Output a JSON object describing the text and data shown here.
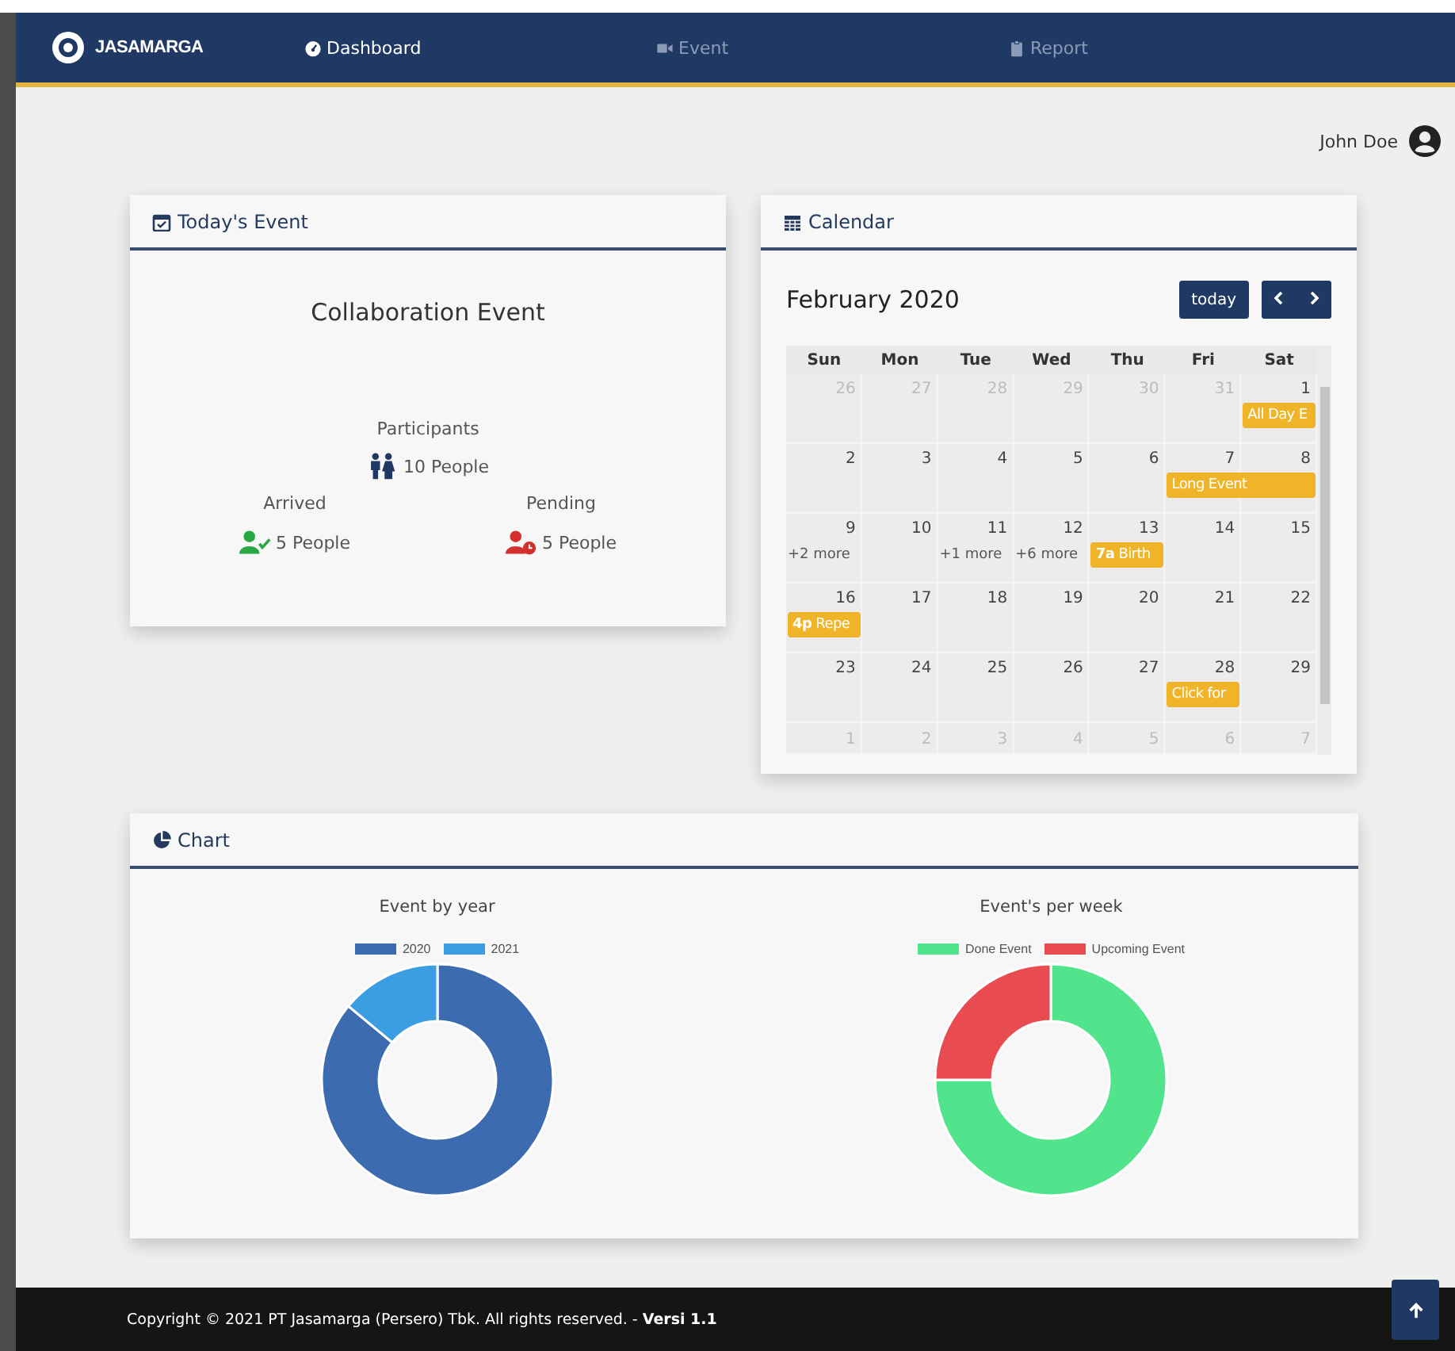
{
  "navbar": {
    "logo": "JASAMARGA",
    "items": [
      {
        "label": "Dashboard",
        "selected": true
      },
      {
        "label": "Event",
        "selected": false
      },
      {
        "label": "Report",
        "selected": false
      }
    ]
  },
  "user": {
    "name": "John Doe"
  },
  "todays_event": {
    "title": "Today's Event",
    "event_name": "Collaboration Event",
    "stats": [
      {
        "kind": "participants",
        "label": "Participants",
        "value": "10 People"
      },
      {
        "kind": "arrived",
        "label": "Arrived",
        "value": "5 People"
      },
      {
        "kind": "pending",
        "label": "Pending",
        "value": "5 People"
      }
    ]
  },
  "calendar": {
    "title": "Calendar",
    "month": "February 2020",
    "today_button": "today",
    "weekdays": [
      "Sun",
      "Mon",
      "Tue",
      "Wed",
      "Thu",
      "Fri",
      "Sat"
    ],
    "weeks": [
      {
        "days": [
          {
            "n": "26",
            "other": true
          },
          {
            "n": "27",
            "other": true
          },
          {
            "n": "28",
            "other": true
          },
          {
            "n": "29",
            "other": true
          },
          {
            "n": "30",
            "other": true
          },
          {
            "n": "31",
            "other": true
          },
          {
            "n": "1",
            "other": false,
            "events": [
              {
                "kind": "event",
                "title": "All Day E"
              }
            ]
          }
        ]
      },
      {
        "days": [
          {
            "n": "2",
            "other": false
          },
          {
            "n": "3",
            "other": false
          },
          {
            "n": "4",
            "other": false
          },
          {
            "n": "5",
            "other": false
          },
          {
            "n": "6",
            "other": false
          },
          {
            "n": "7",
            "other": false,
            "events": [
              {
                "kind": "multi-day",
                "title": "Long Event"
              }
            ]
          },
          {
            "n": "8",
            "other": false
          }
        ]
      },
      {
        "days": [
          {
            "n": "9",
            "other": false,
            "events": [
              {
                "kind": "more",
                "title": "+2 more"
              }
            ]
          },
          {
            "n": "10",
            "other": false
          },
          {
            "n": "11",
            "other": false,
            "events": [
              {
                "kind": "more",
                "title": "+1 more"
              }
            ]
          },
          {
            "n": "12",
            "other": false,
            "events": [
              {
                "kind": "more",
                "title": "+6 more"
              }
            ]
          },
          {
            "n": "13",
            "other": false,
            "events": [
              {
                "kind": "event",
                "title": "**7a** Birth"
              }
            ]
          },
          {
            "n": "14",
            "other": false
          },
          {
            "n": "15",
            "other": false
          }
        ]
      },
      {
        "days": [
          {
            "n": "16",
            "other": false,
            "events": [
              {
                "kind": "event",
                "title": "**4p** Repe"
              }
            ]
          },
          {
            "n": "17",
            "other": false
          },
          {
            "n": "18",
            "other": false
          },
          {
            "n": "19",
            "other": false
          },
          {
            "n": "20",
            "other": false
          },
          {
            "n": "21",
            "other": false
          },
          {
            "n": "22",
            "other": false
          }
        ]
      },
      {
        "days": [
          {
            "n": "23",
            "other": false
          },
          {
            "n": "24",
            "other": false
          },
          {
            "n": "25",
            "other": false
          },
          {
            "n": "26",
            "other": false
          },
          {
            "n": "27",
            "other": false
          },
          {
            "n": "28",
            "other": false,
            "events": [
              {
                "kind": "event",
                "title": "Click for"
              }
            ]
          },
          {
            "n": "29",
            "other": false
          }
        ]
      },
      {
        "days": [
          {
            "n": "1",
            "other": true
          },
          {
            "n": "2",
            "other": true
          },
          {
            "n": "3",
            "other": true
          },
          {
            "n": "4",
            "other": true
          },
          {
            "n": "5",
            "other": true
          },
          {
            "n": "6",
            "other": true
          },
          {
            "n": "7",
            "other": true
          }
        ]
      }
    ]
  },
  "chart": {
    "title": "Chart",
    "charts": [
      {
        "chart_data": {
          "type": "donut",
          "title": "Event by year",
          "categories": [
            "2020",
            "2021"
          ],
          "series": [
            {
              "values": [
                86,
                14
              ]
            }
          ],
          "colors": [
            "#3d6bb0",
            "#3b9de2"
          ]
        }
      },
      {
        "chart_data": {
          "type": "donut",
          "title": "Event's per week",
          "categories": [
            "Done Event",
            "Upcoming Event"
          ],
          "series": [
            {
              "values": [
                75,
                25
              ]
            }
          ],
          "colors": [
            "#52e48c",
            "#e84b50"
          ]
        }
      }
    ]
  },
  "footer": {
    "text": "Copyright © 2021 PT Jasamarga (Persero) Tbk. All rights reserved. - **Versi 1.1**"
  }
}
